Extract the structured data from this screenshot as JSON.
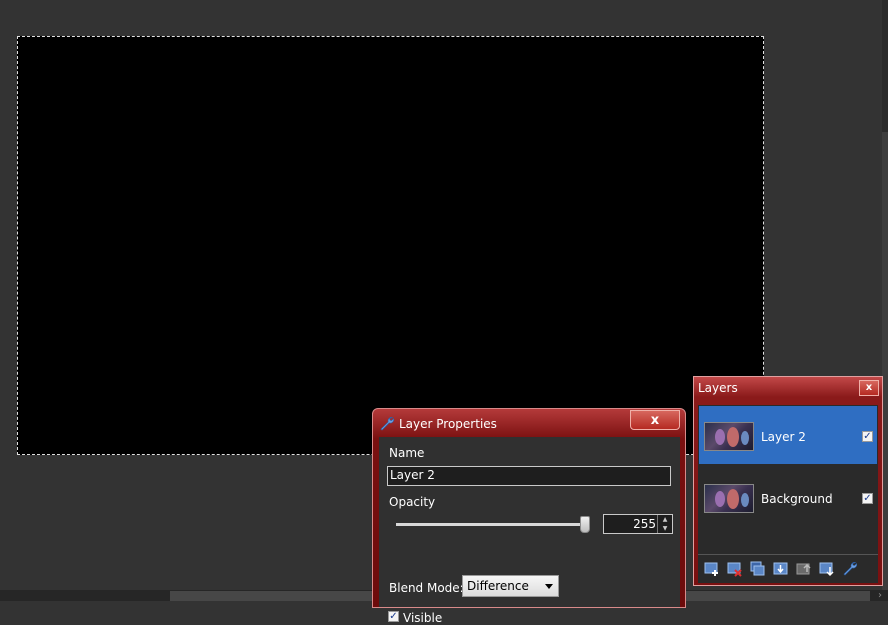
{
  "dialog": {
    "title": "Layer Properties",
    "close": "x",
    "name_label": "Name",
    "name_value": "Layer 2",
    "opacity_label": "Opacity",
    "opacity_value": "255",
    "opacity_fraction": 1.0,
    "blend_label": "Blend Mode:",
    "blend_value": "Difference",
    "visible_label": "Visible",
    "visible_checked": true
  },
  "layers_panel": {
    "title": "Layers",
    "close": "x",
    "layers": [
      {
        "name": "Layer 2",
        "selected": true,
        "visible": true
      },
      {
        "name": "Background",
        "selected": false,
        "visible": true
      }
    ],
    "toolbar": [
      "add-layer-icon",
      "delete-layer-icon",
      "duplicate-layer-icon",
      "merge-layer-down-icon",
      "move-layer-up-icon",
      "move-layer-down-icon",
      "layer-properties-icon"
    ]
  },
  "colors": {
    "accent_red": "#7a1010",
    "selection_blue": "#2f6ec2",
    "workspace": "#333333"
  }
}
